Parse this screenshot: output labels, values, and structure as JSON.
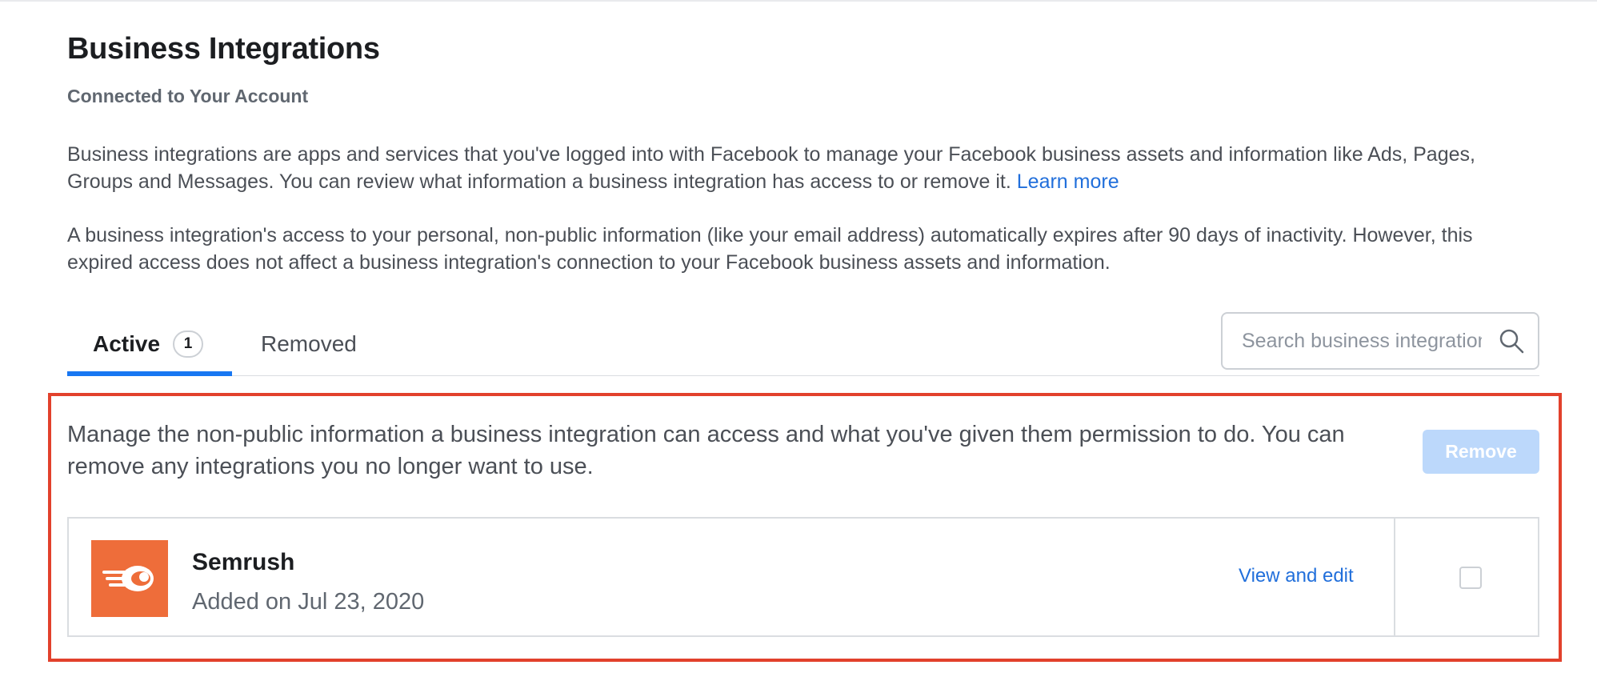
{
  "header": {
    "title": "Business Integrations",
    "subtitle": "Connected to Your Account"
  },
  "intro": {
    "paragraph1_text": "Business integrations are apps and services that you've logged into with Facebook to manage your Facebook business assets and information like Ads, Pages, Groups and Messages. You can review what information a business integration has access to or remove it.",
    "learn_more_label": "Learn more",
    "paragraph2_text": "A business integration's access to your personal, non-public information (like your email address) automatically expires after 90 days of inactivity. However, this expired access does not affect a business integration's connection to your Facebook business assets and information."
  },
  "tabs": {
    "active_label": "Active",
    "active_count": "1",
    "removed_label": "Removed"
  },
  "search": {
    "placeholder": "Search business integrations",
    "value": "",
    "icon": "search-icon"
  },
  "manage": {
    "description": "Manage the non-public information a business integration can access and what you've given them permission to do. You can remove any integrations you no longer want to use.",
    "remove_label": "Remove"
  },
  "integrations": [
    {
      "name": "Semrush",
      "added": "Added on Jul 23, 2020",
      "view_edit_label": "View and edit",
      "logo_icon": "semrush-logo-icon",
      "selected": false
    }
  ],
  "colors": {
    "accent": "#1877f2",
    "link": "#216fdb",
    "remove_disabled": "#bcd8fb",
    "highlight_frame": "#e2412c",
    "semrush_logo_bg": "#ee6d3a"
  }
}
